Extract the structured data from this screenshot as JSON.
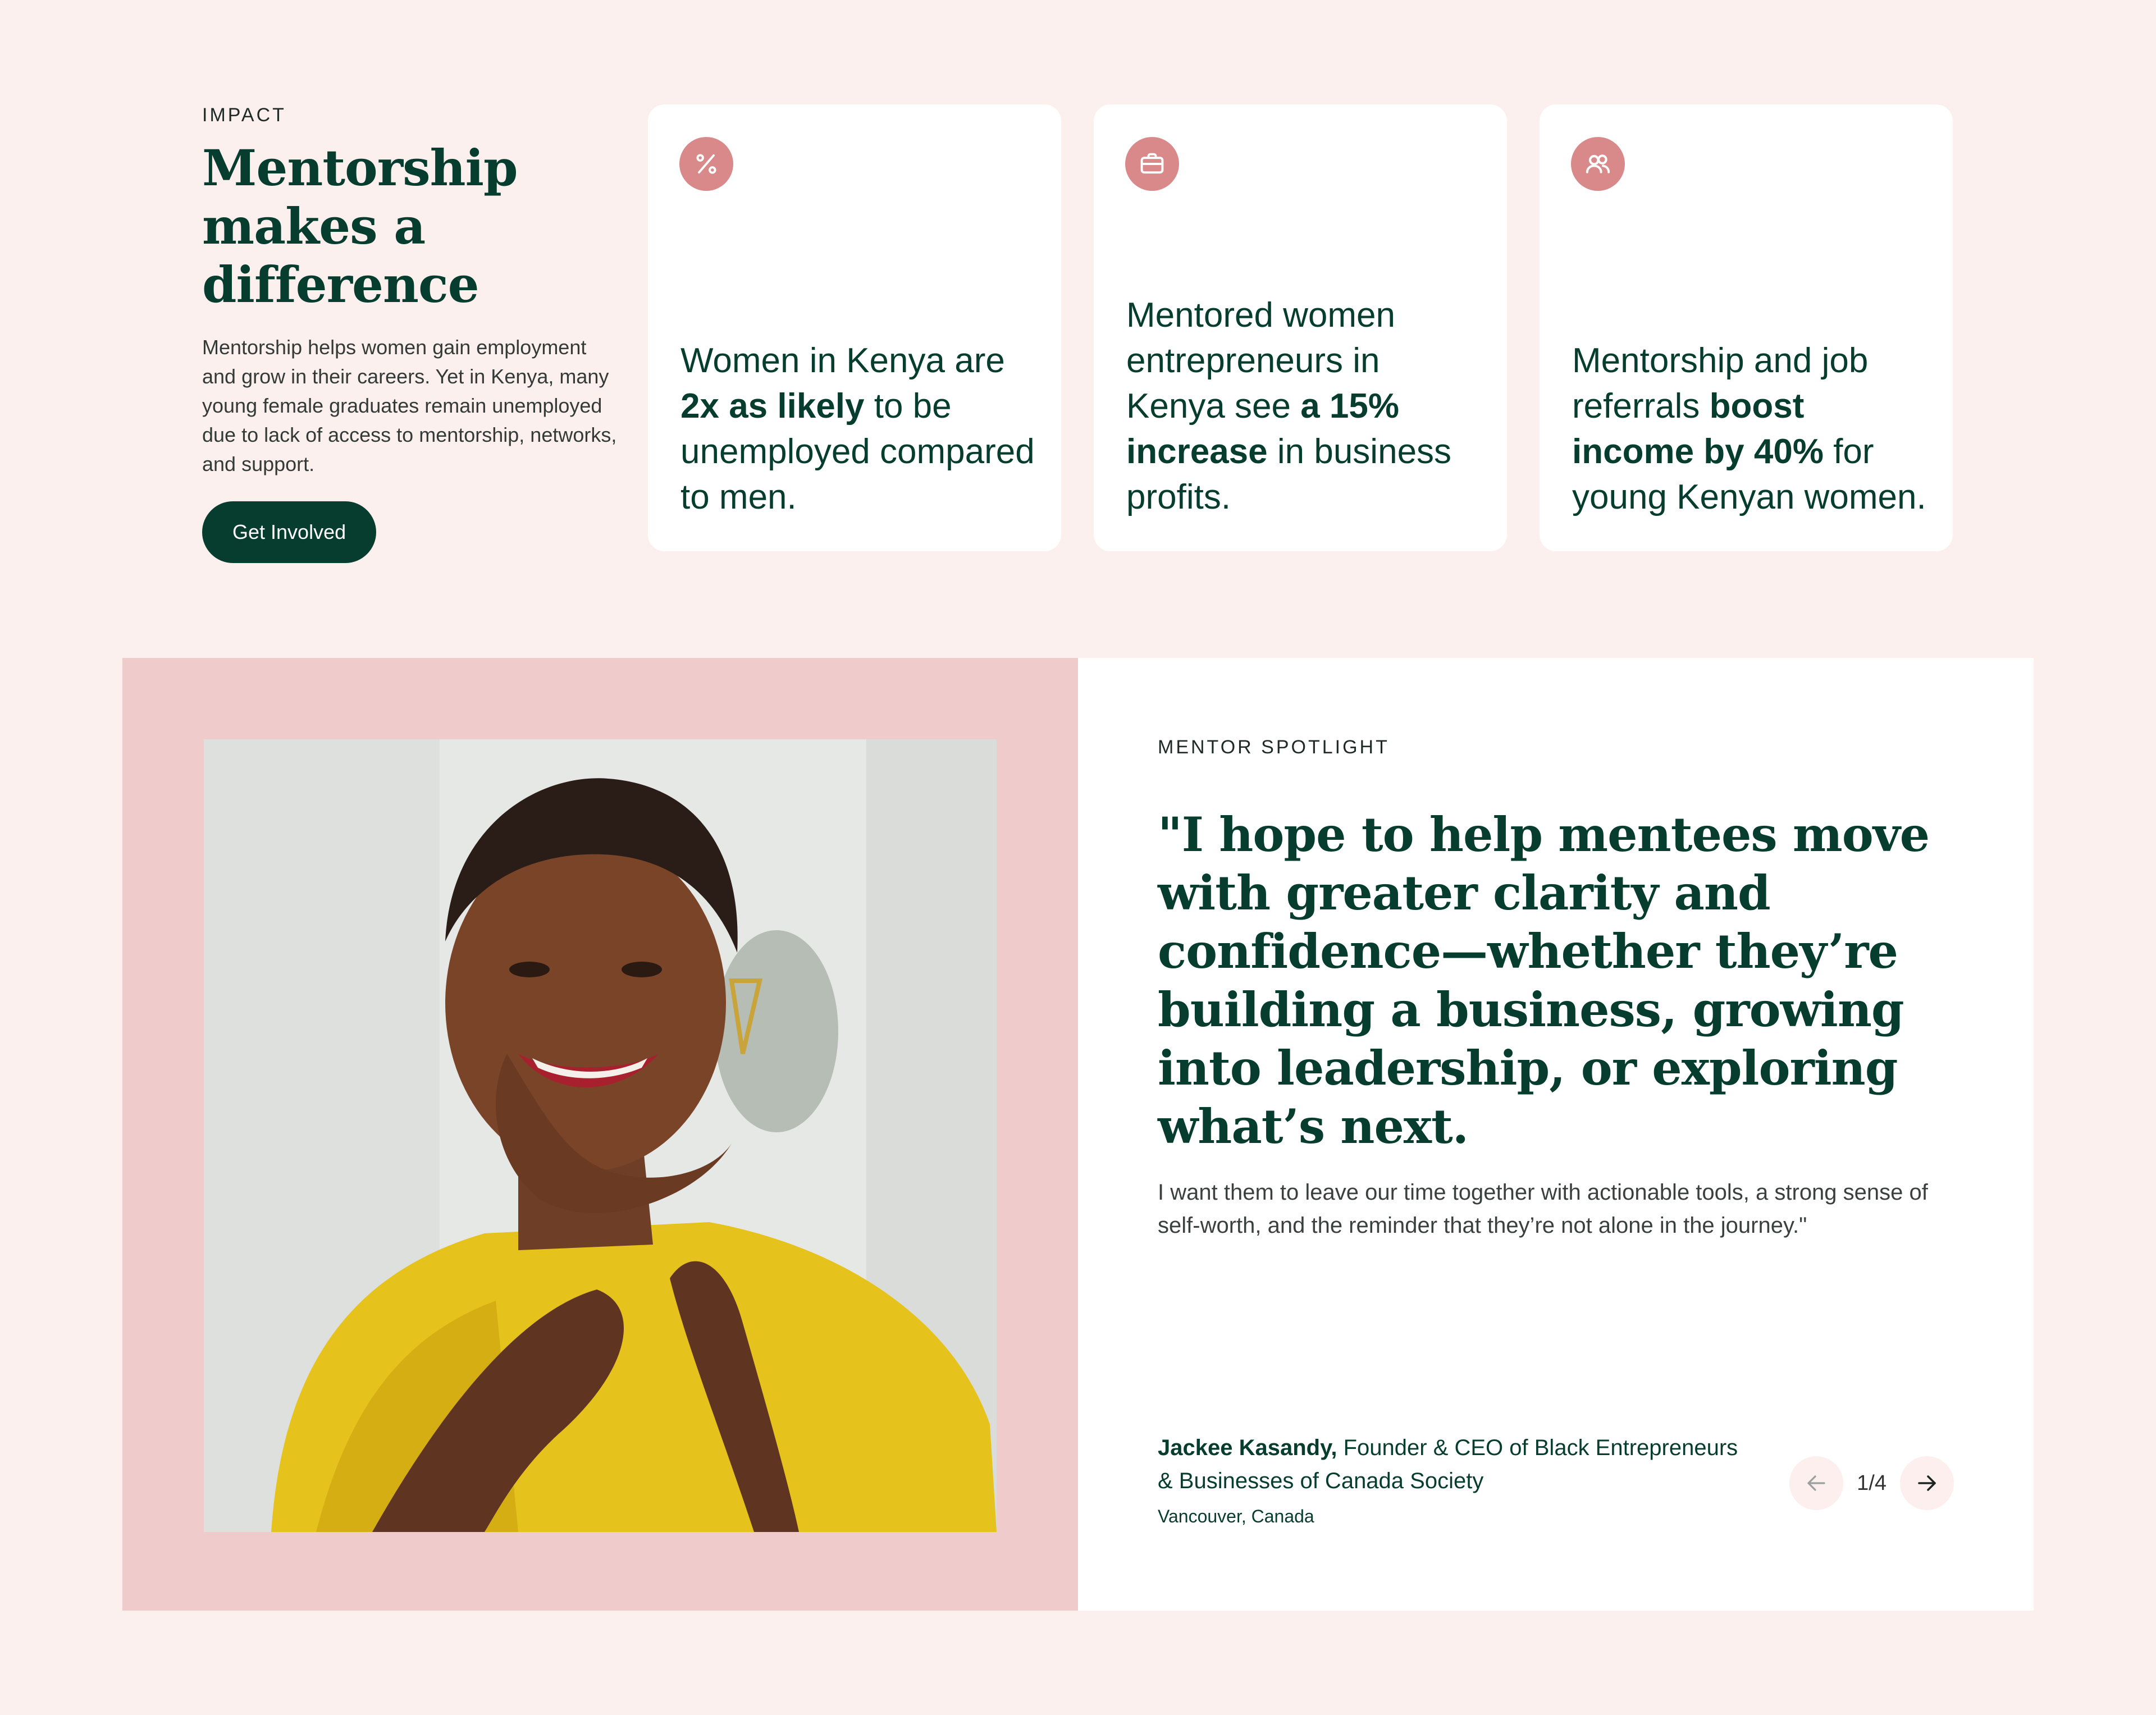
{
  "impact": {
    "eyebrow": "IMPACT",
    "title": "Mentorship makes a difference",
    "body": "Mentorship helps women gain employment and grow in their careers. Yet in Kenya, many young female graduates remain unemployed due to lack of access to mentorship, networks, and support.",
    "cta_label": "Get Involved"
  },
  "stats": [
    {
      "icon": "percent-icon",
      "pre": "Women in Kenya are ",
      "bold": "2x as likely",
      "post": " to be unemployed compared to men."
    },
    {
      "icon": "briefcase-icon",
      "pre": "Mentored women entrepreneurs in Kenya see ",
      "bold": "a 15% increase",
      "post": " in business profits."
    },
    {
      "icon": "users-icon",
      "pre": "Mentorship and job referrals ",
      "bold": "boost income by 40%",
      "post": " for young Kenyan women."
    }
  ],
  "colors": {
    "accent": "#073d2e",
    "icon_bg": "#d98989",
    "page_bg": "#fcf0ee",
    "photo_panel_bg": "#efcccb"
  },
  "spotlight": {
    "eyebrow": "MENTOR SPOTLIGHT",
    "quote_title": "\"I hope to help mentees move with greater clarity and confidence—whether they’re building a business, growing into leadership, or exploring what’s next.",
    "quote_body": "I want them to leave our time together with actionable tools, a strong sense of self-worth, and the reminder that they’re not alone in the journey.\"",
    "name": "Jackee Kasandy,",
    "role": " Founder & CEO of Black Entrepreneurs & Businesses of Canada Society",
    "location": "Vancouver, Canada",
    "pager": "1/4",
    "photo_icon": "mentor-portrait"
  }
}
